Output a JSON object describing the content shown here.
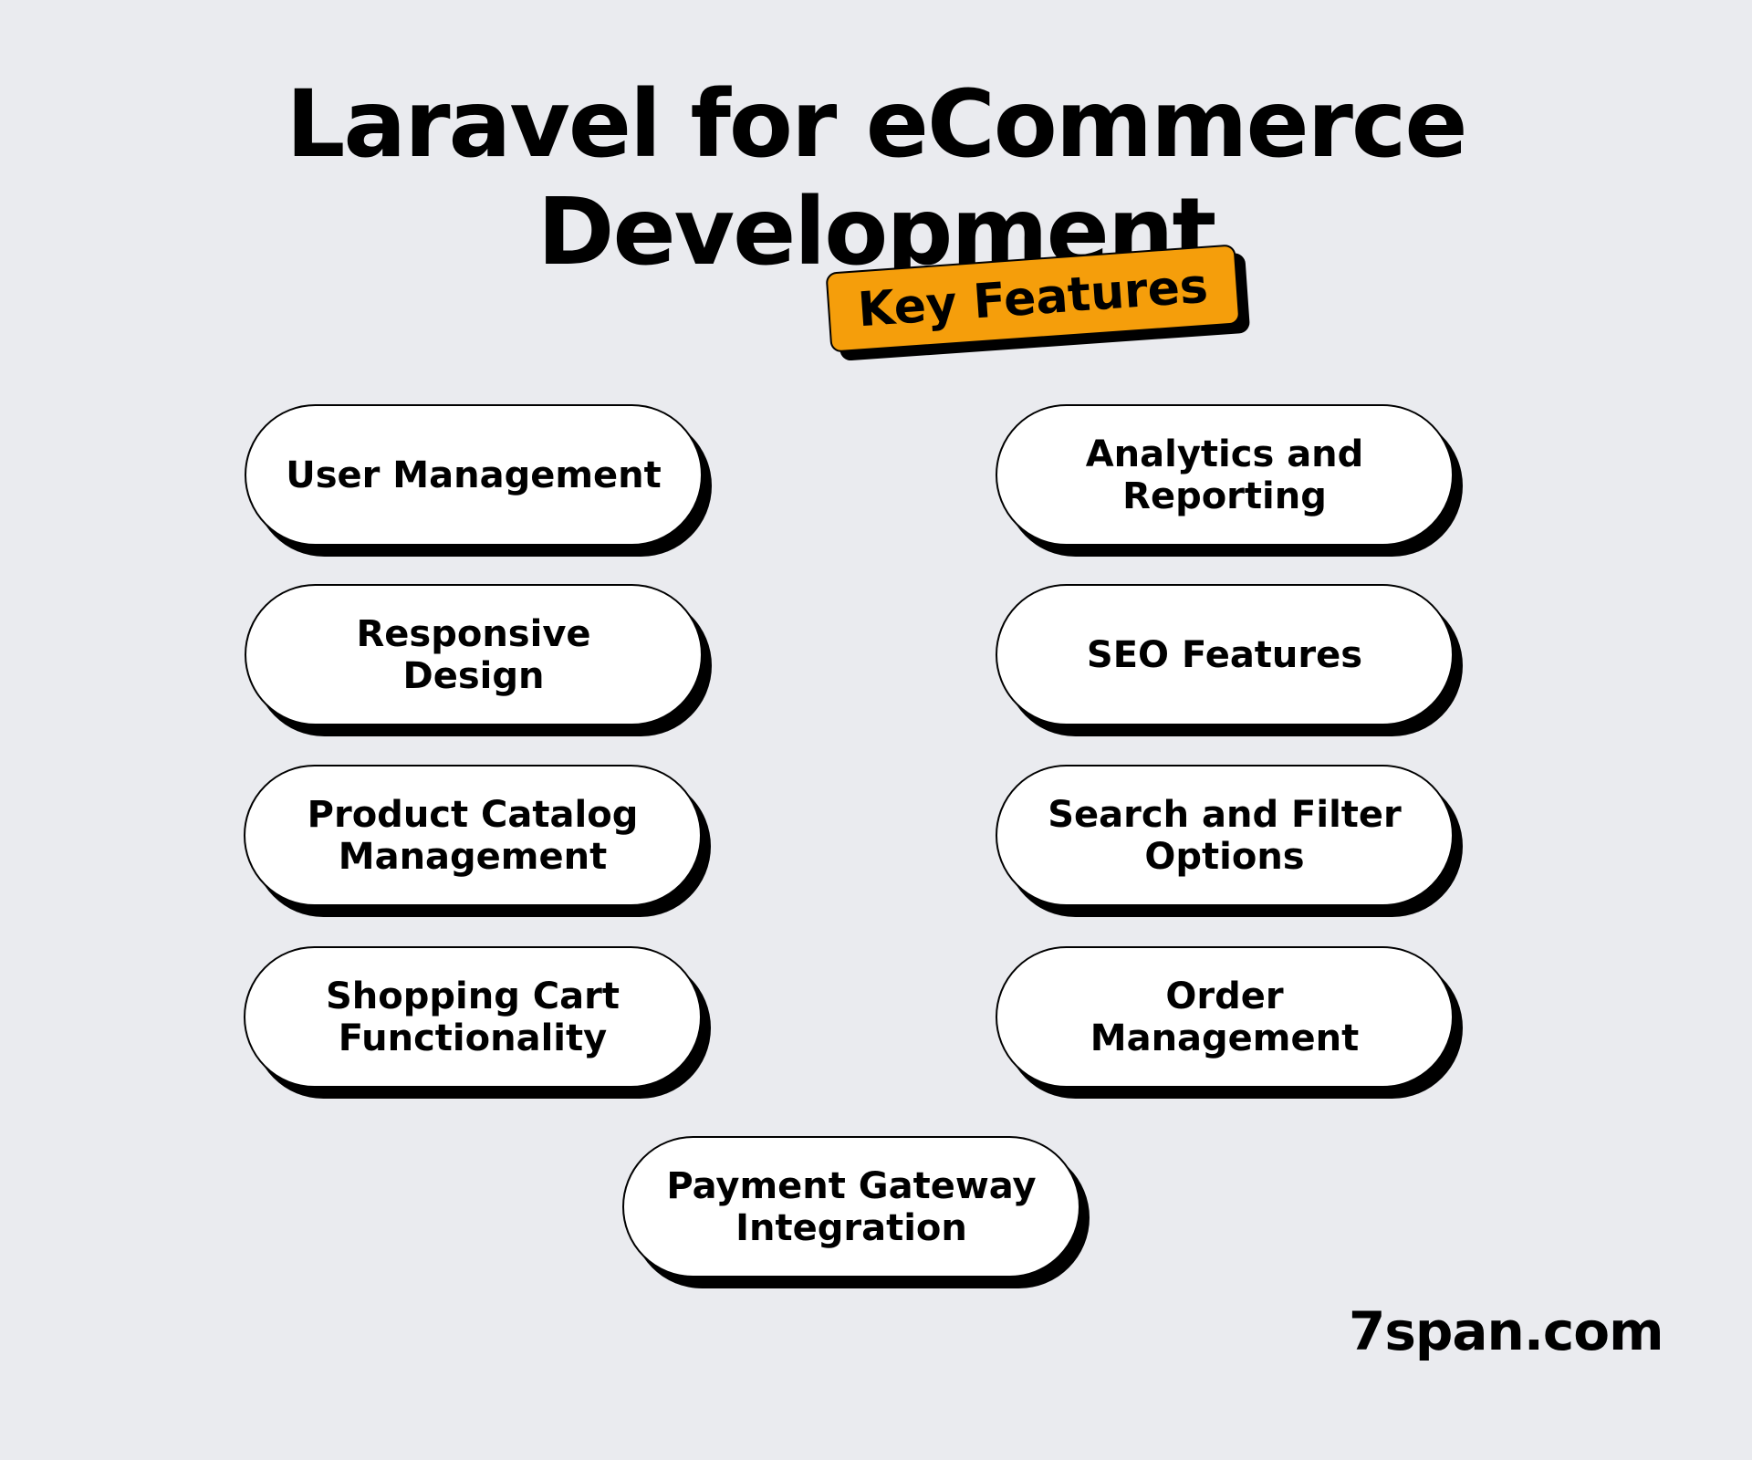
{
  "title": {
    "line1": "Laravel for eCommerce",
    "line2": "Development"
  },
  "badge": {
    "label": "Key Features",
    "color": "#F59E0B"
  },
  "features": {
    "left": [
      "User Management",
      "Responsive Design",
      "Product Catalog Management",
      "Shopping Cart Functionality"
    ],
    "right": [
      "Analytics and Reporting",
      "SEO Features",
      "Search and Filter Options",
      "Order Management"
    ],
    "bottom": "Payment Gateway Integration"
  },
  "brand": "7span.com",
  "colors": {
    "background": "#EAEBEF",
    "pill": "#FFFFFF",
    "outline": "#000000"
  }
}
